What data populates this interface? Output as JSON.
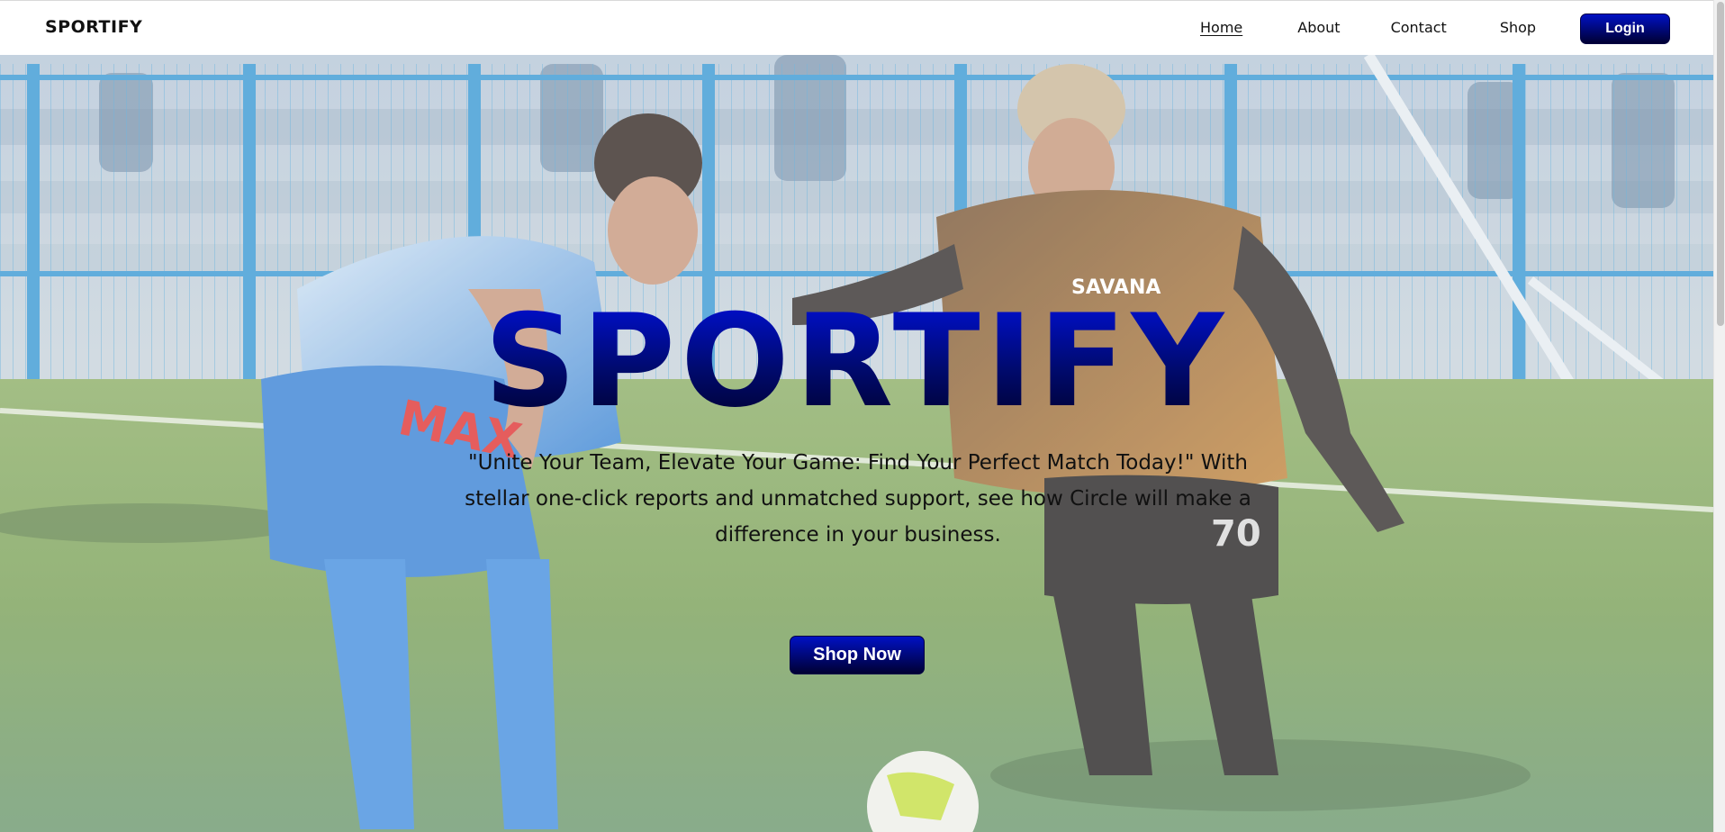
{
  "navbar": {
    "brand": "SPORTIFY",
    "links": [
      {
        "label": "Home",
        "active": true
      },
      {
        "label": "About",
        "active": false
      },
      {
        "label": "Contact",
        "active": false
      },
      {
        "label": "Shop",
        "active": false
      }
    ],
    "login_label": "Login"
  },
  "hero": {
    "title": "SPORTIFY",
    "tagline": "\"Unite Your Team, Elevate Your Game: Find Your Perfect Match Today!\" With stellar one-click reports and unmatched support, see how Circle will make a difference in your business.",
    "cta_label": "Shop Now",
    "background_image": "photo of two football players, one in a blue kit and one in a brown kit with SAVANA sponsor and number 70, contesting a ball on a green pitch in front of a blue fence and stands",
    "jersey_texts": [
      "MAX",
      "SAVANA",
      "70"
    ]
  },
  "colors": {
    "accent_dark": "#000033",
    "accent_bright": "#0011c4",
    "title_blue": "#0010d8"
  }
}
